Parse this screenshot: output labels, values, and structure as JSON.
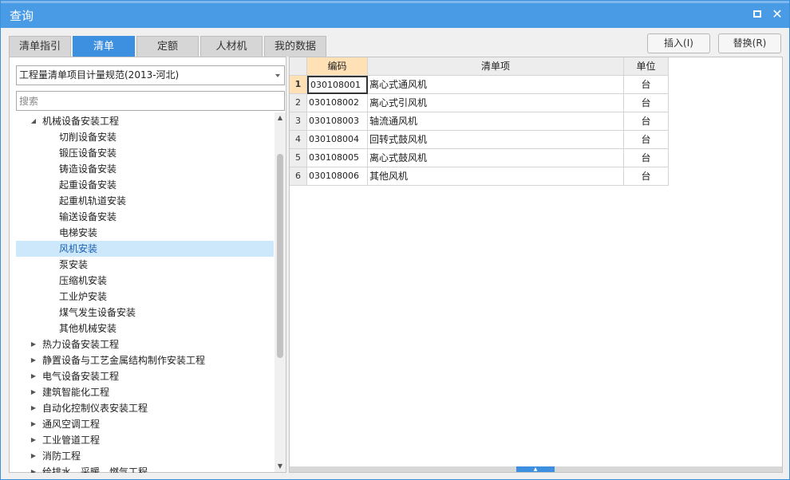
{
  "window": {
    "title": "查询"
  },
  "tabs": [
    {
      "label": "清单指引",
      "active": false
    },
    {
      "label": "清单",
      "active": true
    },
    {
      "label": "定额",
      "active": false
    },
    {
      "label": "人材机",
      "active": false
    },
    {
      "label": "我的数据",
      "active": false
    }
  ],
  "actions": {
    "insert_label": "插入(I)",
    "replace_label": "替换(R)"
  },
  "left": {
    "standard_select_value": "工程量清单项目计量规范(2013-河北)",
    "search_placeholder": "搜索",
    "tree": [
      {
        "label": "机械设备安装工程",
        "level": 0,
        "expanded": true
      },
      {
        "label": "切削设备安装",
        "level": 1
      },
      {
        "label": "锻压设备安装",
        "level": 1
      },
      {
        "label": "铸造设备安装",
        "level": 1
      },
      {
        "label": "起重设备安装",
        "level": 1
      },
      {
        "label": "起重机轨道安装",
        "level": 1
      },
      {
        "label": "输送设备安装",
        "level": 1
      },
      {
        "label": "电梯安装",
        "level": 1
      },
      {
        "label": "风机安装",
        "level": 1,
        "selected": true
      },
      {
        "label": "泵安装",
        "level": 1
      },
      {
        "label": "压缩机安装",
        "level": 1
      },
      {
        "label": "工业炉安装",
        "level": 1
      },
      {
        "label": "煤气发生设备安装",
        "level": 1
      },
      {
        "label": "其他机械安装",
        "level": 1
      },
      {
        "label": "热力设备安装工程",
        "level": 0,
        "expanded": false
      },
      {
        "label": "静置设备与工艺金属结构制作安装工程",
        "level": 0,
        "expanded": false
      },
      {
        "label": "电气设备安装工程",
        "level": 0,
        "expanded": false
      },
      {
        "label": "建筑智能化工程",
        "level": 0,
        "expanded": false
      },
      {
        "label": "自动化控制仪表安装工程",
        "level": 0,
        "expanded": false
      },
      {
        "label": "通风空调工程",
        "level": 0,
        "expanded": false
      },
      {
        "label": "工业管道工程",
        "level": 0,
        "expanded": false
      },
      {
        "label": "消防工程",
        "level": 0,
        "expanded": false
      },
      {
        "label": "给排水、采暖、燃气工程",
        "level": 0,
        "expanded": false
      }
    ]
  },
  "table": {
    "columns": [
      "编码",
      "清单项",
      "单位"
    ],
    "rows": [
      {
        "num": "1",
        "code": "030108001",
        "name": "离心式通风机",
        "unit": "台"
      },
      {
        "num": "2",
        "code": "030108002",
        "name": "离心式引风机",
        "unit": "台"
      },
      {
        "num": "3",
        "code": "030108003",
        "name": "轴流通风机",
        "unit": "台"
      },
      {
        "num": "4",
        "code": "030108004",
        "name": "回转式鼓风机",
        "unit": "台"
      },
      {
        "num": "5",
        "code": "030108005",
        "name": "离心式鼓风机",
        "unit": "台"
      },
      {
        "num": "6",
        "code": "030108006",
        "name": "其他风机",
        "unit": "台"
      }
    ]
  },
  "colors": {
    "titlebar": "#4a9be6",
    "active_tab": "#3d8fe0",
    "selected_tree_row": "#cde8fb",
    "current_row_header": "#ffe1b5"
  }
}
